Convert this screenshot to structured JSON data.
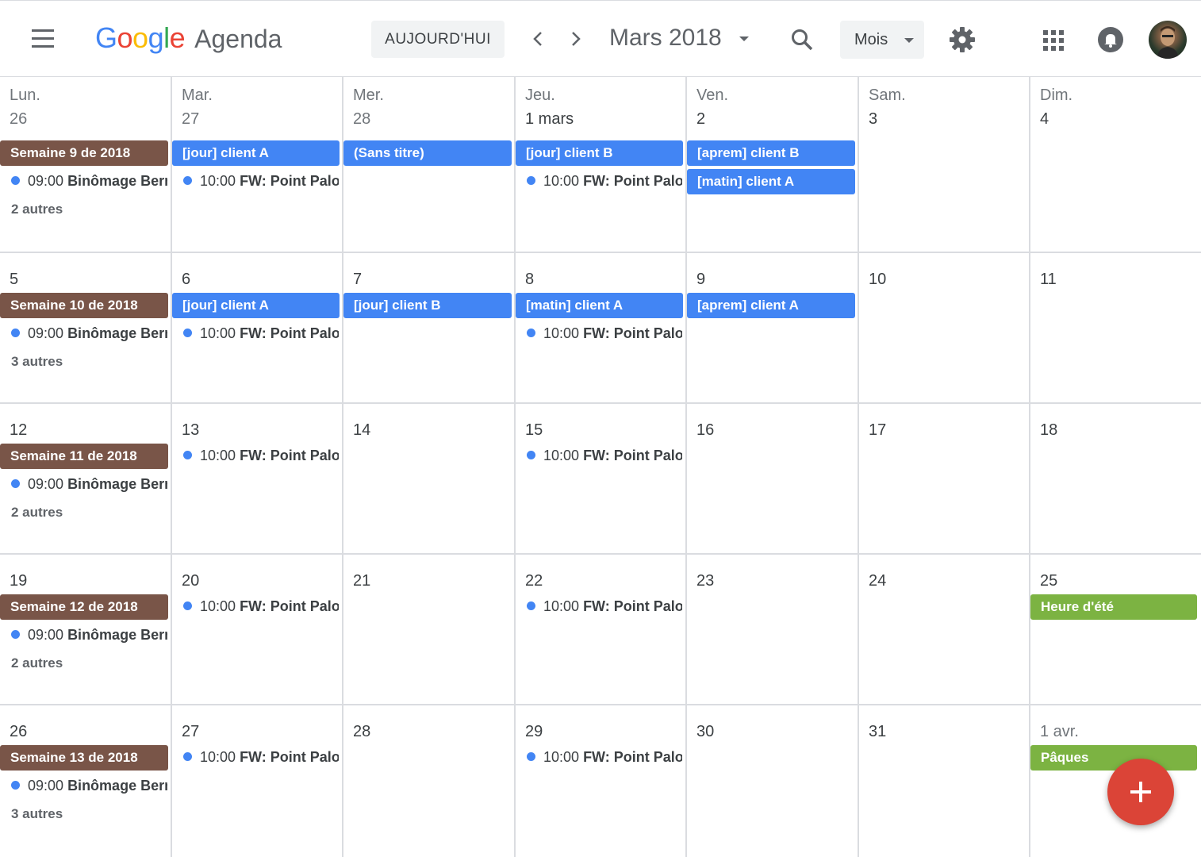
{
  "header": {
    "logo_google": [
      "G",
      "o",
      "o",
      "g",
      "l",
      "e"
    ],
    "logo_agenda": "Agenda",
    "today_label": "AUJOURD'HUI",
    "month_title": "Mars 2018",
    "view_label": "Mois"
  },
  "colors": {
    "accent": "#4285f4",
    "week_event": "#795548",
    "holiday": "#7cb342",
    "fab": "#db4437"
  },
  "days_of_week": [
    "Lun.",
    "Mar.",
    "Mer.",
    "Jeu.",
    "Ven.",
    "Sam.",
    "Dim."
  ],
  "weeks": [
    {
      "days": [
        {
          "num": "26",
          "other": true,
          "bars": [
            {
              "label": "Semaine 9 de 2018",
              "color": "brown"
            }
          ],
          "events": [
            {
              "time": "09:00",
              "title": "Binômage Bern"
            }
          ],
          "more": "2 autres"
        },
        {
          "num": "27",
          "other": true,
          "bars": [
            {
              "label": "[jour] client A",
              "color": "blue"
            }
          ],
          "events": [
            {
              "time": "10:00",
              "title": "FW: Point Palo-"
            }
          ]
        },
        {
          "num": "28",
          "other": true,
          "bars": [
            {
              "label": "(Sans titre)",
              "color": "blue"
            }
          ],
          "events": []
        },
        {
          "num": "1 mars",
          "bars": [
            {
              "label": "[jour] client B",
              "color": "blue"
            }
          ],
          "events": [
            {
              "time": "10:00",
              "title": "FW: Point Palo-"
            }
          ]
        },
        {
          "num": "2",
          "bars": [
            {
              "label": "[aprem] client B",
              "color": "blue"
            },
            {
              "label": "[matin] client A",
              "color": "blue"
            }
          ],
          "events": []
        },
        {
          "num": "3",
          "bars": [],
          "events": []
        },
        {
          "num": "4",
          "bars": [],
          "events": []
        }
      ]
    },
    {
      "days": [
        {
          "num": "5",
          "bars": [
            {
              "label": "Semaine 10 de 2018",
              "color": "brown"
            }
          ],
          "events": [
            {
              "time": "09:00",
              "title": "Binômage Bern"
            }
          ],
          "more": "3 autres"
        },
        {
          "num": "6",
          "bars": [
            {
              "label": "[jour] client A",
              "color": "blue"
            }
          ],
          "events": [
            {
              "time": "10:00",
              "title": "FW: Point Palo-"
            }
          ]
        },
        {
          "num": "7",
          "bars": [
            {
              "label": "[jour] client B",
              "color": "blue"
            }
          ],
          "events": []
        },
        {
          "num": "8",
          "bars": [
            {
              "label": "[matin] client A",
              "color": "blue"
            }
          ],
          "events": [
            {
              "time": "10:00",
              "title": "FW: Point Palo-"
            }
          ]
        },
        {
          "num": "9",
          "bars": [
            {
              "label": "[aprem] client A",
              "color": "blue"
            }
          ],
          "events": []
        },
        {
          "num": "10",
          "bars": [],
          "events": []
        },
        {
          "num": "11",
          "bars": [],
          "events": []
        }
      ]
    },
    {
      "days": [
        {
          "num": "12",
          "bars": [
            {
              "label": "Semaine 11 de 2018",
              "color": "brown"
            }
          ],
          "events": [
            {
              "time": "09:00",
              "title": "Binômage Bern"
            }
          ],
          "more": "2 autres"
        },
        {
          "num": "13",
          "bars": [],
          "events": [
            {
              "time": "10:00",
              "title": "FW: Point Palo-"
            }
          ]
        },
        {
          "num": "14",
          "bars": [],
          "events": []
        },
        {
          "num": "15",
          "bars": [],
          "events": [
            {
              "time": "10:00",
              "title": "FW: Point Palo-"
            }
          ]
        },
        {
          "num": "16",
          "bars": [],
          "events": []
        },
        {
          "num": "17",
          "bars": [],
          "events": []
        },
        {
          "num": "18",
          "bars": [],
          "events": []
        }
      ]
    },
    {
      "days": [
        {
          "num": "19",
          "bars": [
            {
              "label": "Semaine 12 de 2018",
              "color": "brown"
            }
          ],
          "events": [
            {
              "time": "09:00",
              "title": "Binômage Bern"
            }
          ],
          "more": "2 autres"
        },
        {
          "num": "20",
          "bars": [],
          "events": [
            {
              "time": "10:00",
              "title": "FW: Point Palo-"
            }
          ]
        },
        {
          "num": "21",
          "bars": [],
          "events": []
        },
        {
          "num": "22",
          "bars": [],
          "events": [
            {
              "time": "10:00",
              "title": "FW: Point Palo-"
            }
          ]
        },
        {
          "num": "23",
          "bars": [],
          "events": []
        },
        {
          "num": "24",
          "bars": [],
          "events": []
        },
        {
          "num": "25",
          "bars": [
            {
              "label": "Heure d'été",
              "color": "green"
            }
          ],
          "events": []
        }
      ]
    },
    {
      "days": [
        {
          "num": "26",
          "bars": [
            {
              "label": "Semaine 13 de 2018",
              "color": "brown"
            }
          ],
          "events": [
            {
              "time": "09:00",
              "title": "Binômage Bern"
            }
          ],
          "more": "3 autres"
        },
        {
          "num": "27",
          "bars": [],
          "events": [
            {
              "time": "10:00",
              "title": "FW: Point Palo-"
            }
          ]
        },
        {
          "num": "28",
          "bars": [],
          "events": []
        },
        {
          "num": "29",
          "bars": [],
          "events": [
            {
              "time": "10:00",
              "title": "FW: Point Palo-"
            }
          ]
        },
        {
          "num": "30",
          "bars": [],
          "events": []
        },
        {
          "num": "31",
          "bars": [],
          "events": []
        },
        {
          "num": "1 avr.",
          "other": true,
          "bars": [
            {
              "label": "Pâques",
              "color": "green"
            }
          ],
          "events": []
        }
      ]
    }
  ]
}
